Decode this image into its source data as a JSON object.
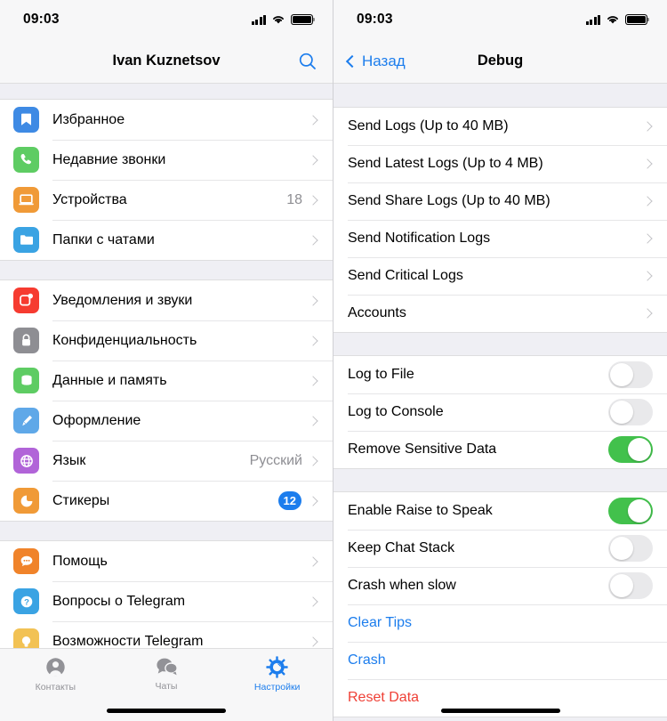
{
  "left": {
    "status": {
      "time": "09:03",
      "signal_icon": "cellular-signal-icon",
      "wifi_icon": "wifi-icon",
      "battery_icon": "battery-full-icon"
    },
    "nav": {
      "title": "Ivan Kuznetsov",
      "search_icon": "search-icon"
    },
    "groups": [
      {
        "rows": [
          {
            "label": "Избранное",
            "icon": "bookmark-icon",
            "color": "#3e8ae4",
            "value": "",
            "badge": ""
          },
          {
            "label": "Недавние звонки",
            "icon": "phone-icon",
            "color": "#5ecc63",
            "value": "",
            "badge": ""
          },
          {
            "label": "Устройства",
            "icon": "laptop-icon",
            "color": "#f09a37",
            "value": "18",
            "badge": ""
          },
          {
            "label": "Папки с чатами",
            "icon": "folder-icon",
            "color": "#3aa3e3",
            "value": "",
            "badge": ""
          }
        ]
      },
      {
        "rows": [
          {
            "label": "Уведомления и звуки",
            "icon": "notifications-icon",
            "color": "#f63b30",
            "value": "",
            "badge": ""
          },
          {
            "label": "Конфиденциальность",
            "icon": "lock-icon",
            "color": "#8e8e93",
            "value": "",
            "badge": ""
          },
          {
            "label": "Данные и память",
            "icon": "database-icon",
            "color": "#5ecc63",
            "value": "",
            "badge": ""
          },
          {
            "label": "Оформление",
            "icon": "paintbrush-icon",
            "color": "#5fa8e8",
            "value": "",
            "badge": ""
          },
          {
            "label": "Язык",
            "icon": "globe-icon",
            "color": "#b164d8",
            "value": "Русский",
            "badge": ""
          },
          {
            "label": "Стикеры",
            "icon": "sticker-icon",
            "color": "#f09a37",
            "value": "",
            "badge": "12"
          }
        ]
      },
      {
        "rows": [
          {
            "label": "Помощь",
            "icon": "chat-help-icon",
            "color": "#f0832a",
            "value": "",
            "badge": ""
          },
          {
            "label": "Вопросы о Telegram",
            "icon": "question-icon",
            "color": "#3aa3e3",
            "value": "",
            "badge": ""
          },
          {
            "label": "Возможности Telegram",
            "icon": "lightbulb-icon",
            "color": "#f2c council",
            "value": "",
            "badge": ""
          }
        ]
      }
    ],
    "tabs": [
      {
        "label": "Контакты",
        "icon": "contacts-icon",
        "active": false
      },
      {
        "label": "Чаты",
        "icon": "chats-icon",
        "active": false
      },
      {
        "label": "Настройки",
        "icon": "settings-gear-icon",
        "active": true
      }
    ]
  },
  "right": {
    "status": {
      "time": "09:03",
      "signal_icon": "cellular-signal-icon",
      "wifi_icon": "wifi-icon",
      "battery_icon": "battery-full-icon"
    },
    "nav": {
      "back_label": "Назад",
      "back_icon": "chevron-left-icon",
      "title": "Debug"
    },
    "group_logs": [
      {
        "label": "Send Logs (Up to 40 MB)"
      },
      {
        "label": "Send Latest Logs (Up to 4 MB)"
      },
      {
        "label": "Send Share Logs (Up to 40 MB)"
      },
      {
        "label": "Send Notification Logs"
      },
      {
        "label": "Send Critical Logs"
      },
      {
        "label": "Accounts"
      }
    ],
    "group_toggles_1": [
      {
        "label": "Log to File",
        "on": false
      },
      {
        "label": "Log to Console",
        "on": false
      },
      {
        "label": "Remove Sensitive Data",
        "on": true
      }
    ],
    "group_toggles_2": [
      {
        "label": "Enable Raise to Speak",
        "on": true
      },
      {
        "label": "Keep Chat Stack",
        "on": false
      },
      {
        "label": "Crash when slow",
        "on": false
      }
    ],
    "group_actions": [
      {
        "label": "Clear Tips",
        "style": "blue"
      },
      {
        "label": "Crash",
        "style": "blue"
      },
      {
        "label": "Reset Data",
        "style": "red"
      }
    ]
  },
  "colors": {
    "accent_blue": "#1c7ded",
    "toggle_green": "#42c14c",
    "destructive_red": "#ef4036",
    "group_bg": "#efeff4"
  }
}
